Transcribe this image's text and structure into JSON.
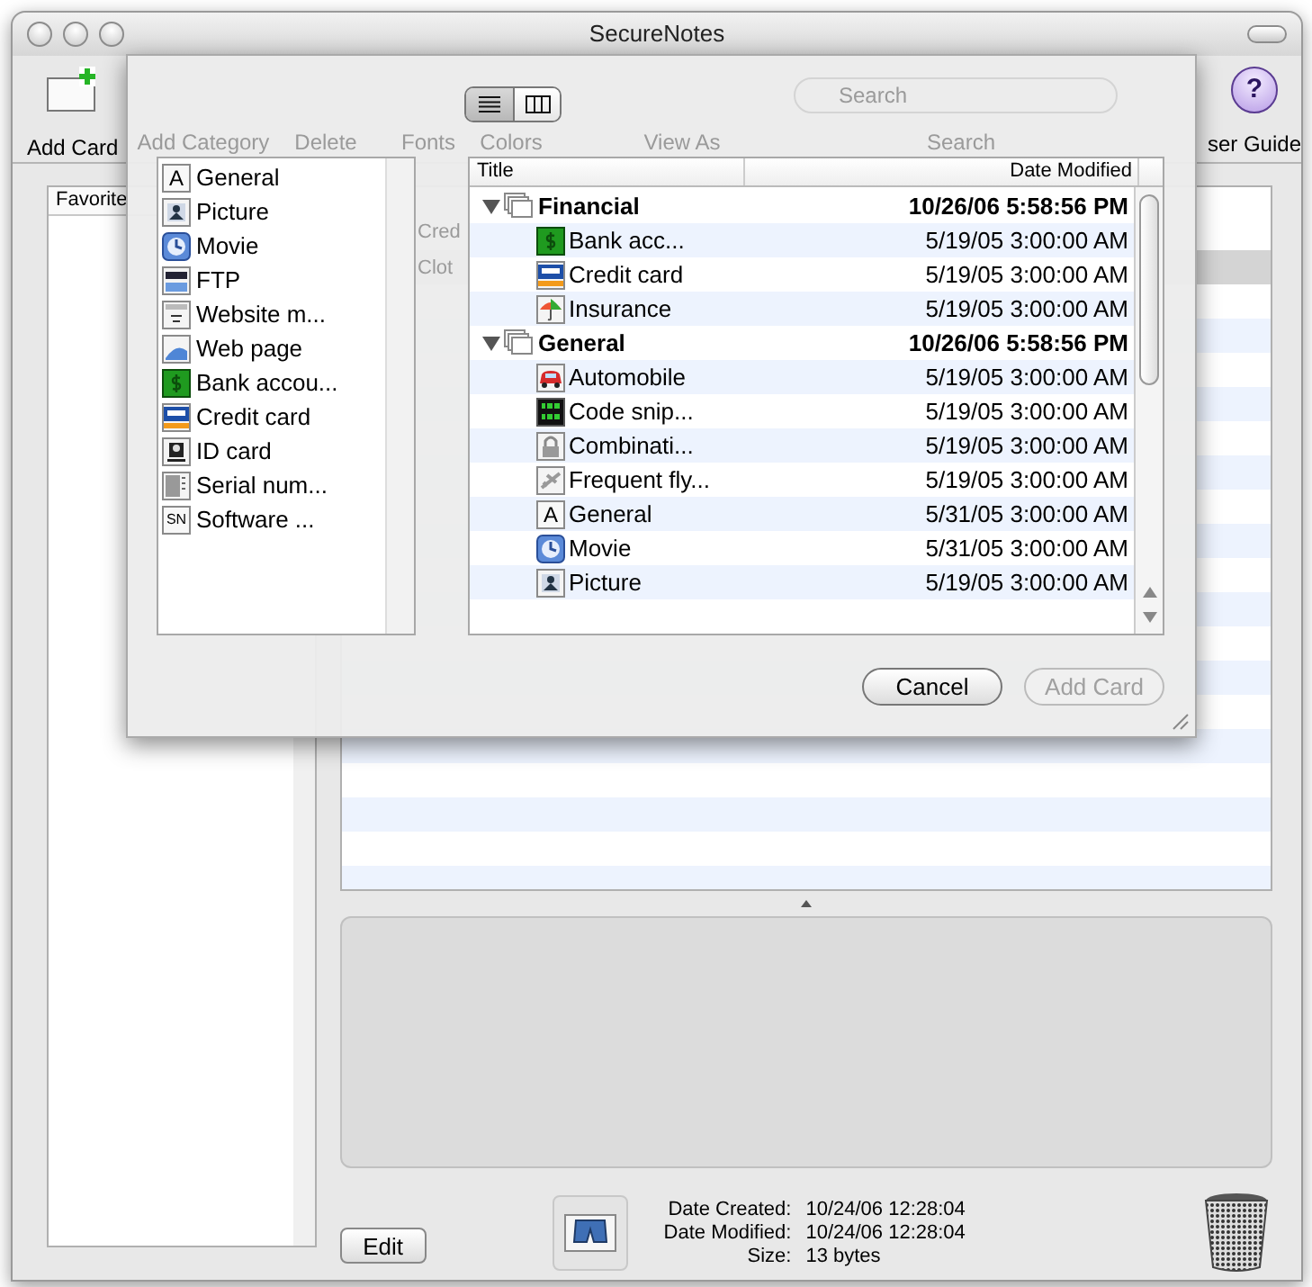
{
  "window": {
    "title": "SecureNotes"
  },
  "toolbar": {
    "items": [
      {
        "label": "Add Card",
        "kind": "add_card"
      },
      {
        "label": "ser Guide",
        "kind": "help",
        "glyph": "?"
      }
    ]
  },
  "faded_toolbar_labels": [
    "Add Category",
    "Delete",
    "Fonts",
    "Colors",
    "View As",
    "Search"
  ],
  "faded_search_placeholder": "Search",
  "faded_list_texts": [
    "Cred",
    "Clot"
  ],
  "sidebar": {
    "header": "Favorite"
  },
  "card_list": {
    "rows": [
      {
        "selected": false
      },
      {
        "selected": true
      },
      {
        "selected": false
      },
      {
        "selected": false
      },
      {
        "selected": false
      },
      {
        "selected": false
      },
      {
        "selected": false
      },
      {
        "selected": false
      },
      {
        "selected": false
      },
      {
        "selected": false
      },
      {
        "selected": false
      },
      {
        "selected": false
      },
      {
        "selected": false
      },
      {
        "selected": false
      },
      {
        "selected": false
      },
      {
        "selected": false
      },
      {
        "selected": false
      },
      {
        "selected": false
      },
      {
        "selected": false
      },
      {
        "selected": false
      }
    ]
  },
  "edit_button": "Edit",
  "info": [
    {
      "label": "Date Created:",
      "value": "10/24/06 12:28:04"
    },
    {
      "label": "Date Modified:",
      "value": "10/24/06 12:28:04"
    },
    {
      "label": "Size:",
      "value": "13 bytes"
    }
  ],
  "sheet": {
    "view_modes": [
      {
        "kind": "list",
        "selected": true
      },
      {
        "kind": "columns",
        "selected": false
      }
    ],
    "templates": [
      {
        "label": "General",
        "kind": "letter",
        "glyph": "A"
      },
      {
        "label": "Picture",
        "kind": "picture"
      },
      {
        "label": "Movie",
        "kind": "movie"
      },
      {
        "label": "FTP",
        "kind": "ftp"
      },
      {
        "label": "Website m...",
        "kind": "website"
      },
      {
        "label": "Web page",
        "kind": "webpage"
      },
      {
        "label": "Bank accou...",
        "kind": "bank"
      },
      {
        "label": "Credit card",
        "kind": "credit"
      },
      {
        "label": "ID card",
        "kind": "idcard"
      },
      {
        "label": "Serial num...",
        "kind": "serial"
      },
      {
        "label": "Software ...",
        "kind": "letter",
        "glyph": "SN"
      }
    ],
    "table": {
      "columns": [
        "Title",
        "Date Modified"
      ],
      "groups": [
        {
          "title": "Financial",
          "date": "10/26/06 5:58:56 PM",
          "expanded": true,
          "children": [
            {
              "title": "Bank acc...",
              "date": "5/19/05 3:00:00 AM",
              "kind": "bank"
            },
            {
              "title": "Credit card",
              "date": "5/19/05 3:00:00 AM",
              "kind": "credit"
            },
            {
              "title": "Insurance",
              "date": "5/19/05 3:00:00 AM",
              "kind": "umbrella"
            }
          ]
        },
        {
          "title": "General",
          "date": "10/26/06 5:58:56 PM",
          "expanded": true,
          "children": [
            {
              "title": "Automobile",
              "date": "5/19/05 3:00:00 AM",
              "kind": "car"
            },
            {
              "title": "Code snip...",
              "date": "5/19/05 3:00:00 AM",
              "kind": "code"
            },
            {
              "title": "Combinati...",
              "date": "5/19/05 3:00:00 AM",
              "kind": "lock"
            },
            {
              "title": "Frequent fly...",
              "date": "5/19/05 3:00:00 AM",
              "kind": "plane"
            },
            {
              "title": "General",
              "date": "5/31/05 3:00:00 AM",
              "kind": "letter",
              "glyph": "A"
            },
            {
              "title": "Movie",
              "date": "5/31/05 3:00:00 AM",
              "kind": "movie"
            },
            {
              "title": "Picture",
              "date": "5/19/05 3:00:00 AM",
              "kind": "picture"
            }
          ]
        }
      ]
    },
    "buttons": [
      {
        "label": "Cancel",
        "disabled": false
      },
      {
        "label": "Add Card",
        "disabled": true
      }
    ]
  }
}
